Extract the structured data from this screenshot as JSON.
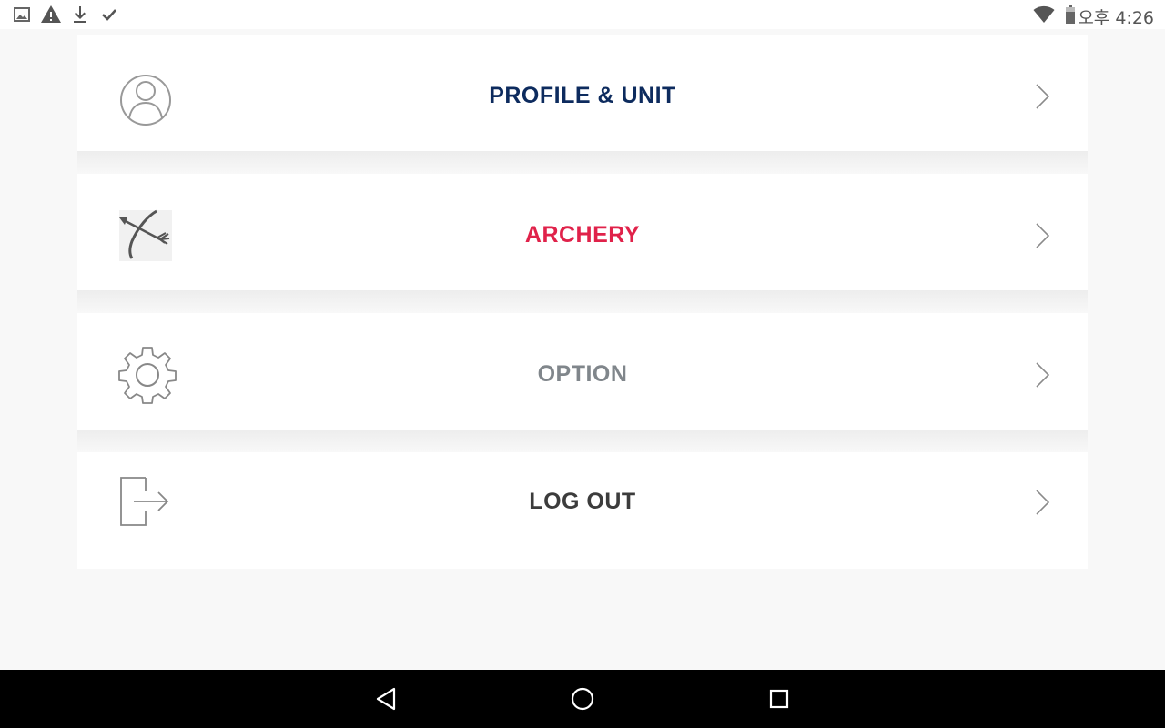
{
  "status_bar": {
    "left_icons": [
      "image-icon",
      "warning-icon",
      "download-icon",
      "check-icon"
    ],
    "right_icons": [
      "wifi-icon",
      "battery-icon"
    ],
    "time": "오후 4:26"
  },
  "menu": {
    "items": [
      {
        "label": "PROFILE & UNIT",
        "icon": "profile-icon",
        "color": "#0d2b5e"
      },
      {
        "label": "ARCHERY",
        "icon": "bow-arrow-icon",
        "color": "#e0224a"
      },
      {
        "label": "OPTION",
        "icon": "gear-icon",
        "color": "#80868b"
      },
      {
        "label": "LOG OUT",
        "icon": "logout-icon",
        "color": "#3c3c3c"
      }
    ]
  },
  "nav_bar": {
    "buttons": [
      "back-button",
      "home-button",
      "recents-button"
    ]
  }
}
